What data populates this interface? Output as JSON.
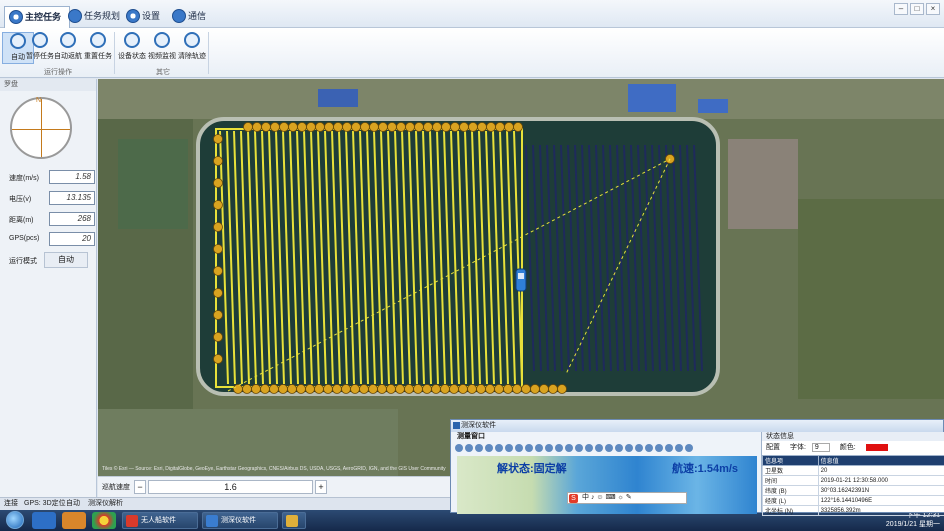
{
  "window": {
    "tabs": [
      {
        "label": "主控任务",
        "active": true
      },
      {
        "label": "任务规划",
        "active": false
      },
      {
        "label": "设置",
        "active": false
      },
      {
        "label": "通信",
        "active": false
      }
    ],
    "controls": [
      "minimize",
      "maximize",
      "close"
    ]
  },
  "ribbon": {
    "group1": {
      "label": "运行操作",
      "buttons": [
        "自动",
        "暂停任务",
        "自动返航",
        "重置任务"
      ]
    },
    "group2": {
      "label": "其它",
      "buttons": [
        "设备状态",
        "视频监视",
        "清除轨迹"
      ]
    }
  },
  "left_panel": {
    "title": "罗盘",
    "compass_label": "N",
    "fields": [
      {
        "label": "速度(m/s)",
        "value": "1.58"
      },
      {
        "label": "电压(v)",
        "value": "13.135"
      },
      {
        "label": "距离(m)",
        "value": "268"
      },
      {
        "label": "GPS(pcs)",
        "value": "20"
      }
    ],
    "mode_label": "运行模式",
    "mode_value": "自动"
  },
  "map": {
    "copyright": "Tiles © Esri — Source: Esri, DigitalGlobe, GeoEye, Earthstar Geographics, CNES/Airbus DS, USDA, USGS, AeroGRID, IGN, and the GIS User Community",
    "colors": {
      "completed_track": "#e8e13a",
      "planned_track": "#1f2a5c",
      "waypoint": "#d9a320",
      "lake": "#1e3d38"
    }
  },
  "speed_bar": {
    "label": "巡航速度",
    "value": "1.6",
    "minus": "−",
    "plus": "+"
  },
  "status": {
    "connection": "连接",
    "gps": "GPS: 3D定位",
    "mode": "自动",
    "sonar": "测深仪解析"
  },
  "taskbar": {
    "items": [
      "无人船软件",
      "测深仪软件",
      ""
    ],
    "time": "下午 12:31",
    "date": "2019/1/21 星期一"
  },
  "sonar_window": {
    "title": "测深仪软件",
    "subtitle": "测量窗口",
    "state_text": "解状态:固定解",
    "speed_text": "航速:1.54m/s",
    "ime_text": "中 ♪ ☺ ⌨ ☼ ✎",
    "info_title": "状态信息",
    "config_label": "配置",
    "font_label": "字体:",
    "font_size": "9",
    "color_label": "颜色:",
    "table_headers": [
      "信息项",
      "信息值"
    ],
    "rows": [
      [
        "卫星数",
        "20"
      ],
      [
        "时间",
        "2019-01-21 12:30:58.000"
      ],
      [
        "纬度 (B)",
        "30°03.16242391N"
      ],
      [
        "经度 (L)",
        "122°16.14410496E"
      ],
      [
        "北坐标 (N)",
        "3325856.392m"
      ]
    ]
  }
}
